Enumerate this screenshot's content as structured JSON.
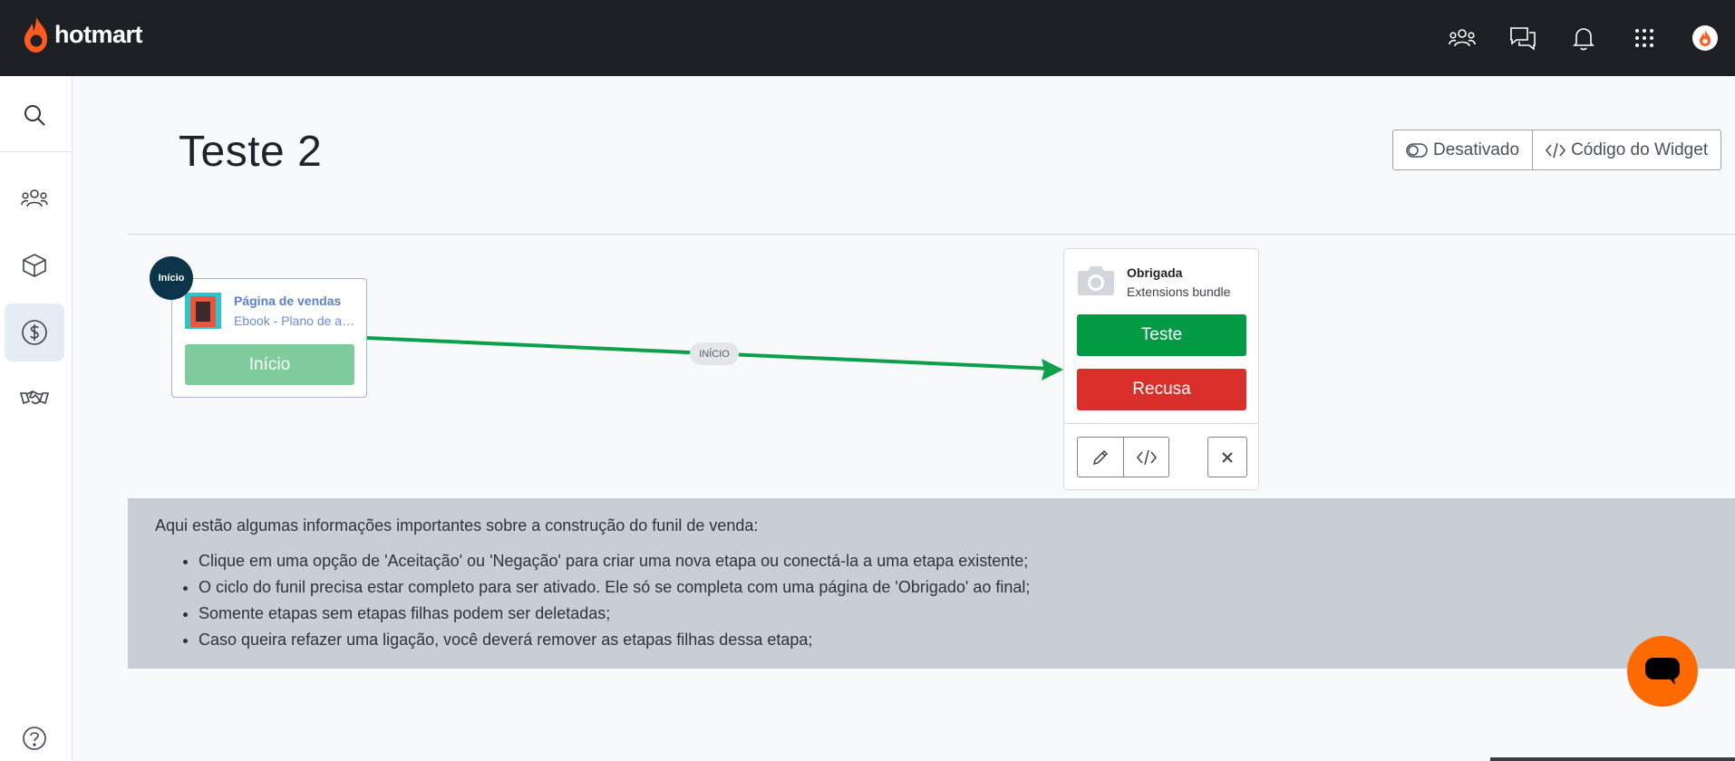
{
  "header": {
    "brand": "hotmart",
    "icons": [
      "community-icon",
      "chat-bubbles-icon",
      "bell-icon",
      "apps-grid-icon",
      "user-avatar"
    ]
  },
  "sidebar": {
    "items": [
      {
        "icon": "search-icon"
      },
      {
        "icon": "users-icon"
      },
      {
        "icon": "box-icon"
      },
      {
        "icon": "dollar-icon",
        "active": true
      },
      {
        "icon": "handshake-icon"
      },
      {
        "icon": "help-icon"
      }
    ]
  },
  "page": {
    "title": "Teste 2",
    "status_label": "Desativado",
    "widget_label": "Código do Widget"
  },
  "funnel": {
    "start_badge": "Início",
    "start_step": {
      "title": "Página de vendas",
      "subtitle": "Ebook - Plano de ação para emagrecer",
      "button": "Início"
    },
    "edge_label": "INÍCIO",
    "thank_you_step": {
      "title": "Obrigada",
      "subtitle": "Extensions bundle",
      "accept_label": "Teste",
      "refuse_label": "Recusa"
    }
  },
  "info": {
    "intro": "Aqui estão algumas informações importantes sobre a construção do funil de venda:",
    "items": [
      "Clique em uma opção de 'Aceitação' ou 'Negação' para criar uma nova etapa ou conectá-la a uma etapa existente;",
      "O ciclo do funil precisa estar completo para ser ativado. Ele só se completa com uma página de 'Obrigado' ao final;",
      "Somente etapas sem etapas filhas podem ser deletadas;",
      "Caso queira refazer uma ligação, você deverá remover as etapas filhas dessa etapa;"
    ]
  },
  "colors": {
    "topbar": "#1c1f23",
    "brand_orange": "#ff6a00",
    "accept_green": "#039a44",
    "refuse_red": "#d9302c",
    "start_badge": "#0b3448"
  }
}
